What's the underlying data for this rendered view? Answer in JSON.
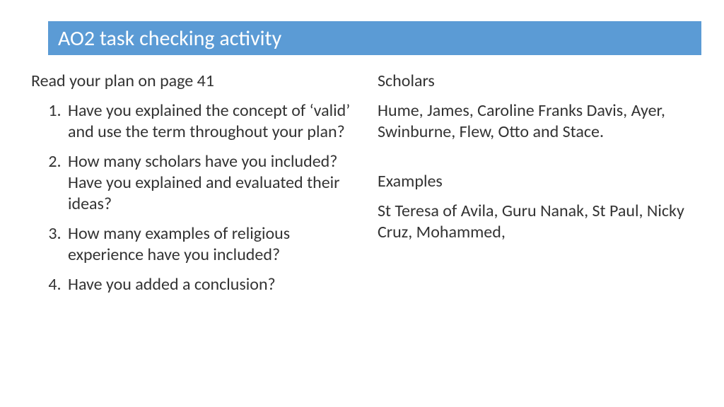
{
  "title": "AO2 task checking activity",
  "left": {
    "intro": "Read your plan on page 41",
    "items": [
      "Have you explained the concept of ‘valid’ and use the term throughout your plan?",
      "How many scholars have you included? Have you explained and evaluated their ideas?",
      "How many examples of religious experience have you included?",
      "Have you added a conclusion?"
    ]
  },
  "right": {
    "scholars_heading": "Scholars",
    "scholars_body": "Hume, James, Caroline Franks Davis, Ayer, Swinburne, Flew, Otto and Stace.",
    "examples_heading": "Examples",
    "examples_body": "St Teresa of Avila, Guru Nanak, St Paul, Nicky Cruz, Mohammed,"
  }
}
